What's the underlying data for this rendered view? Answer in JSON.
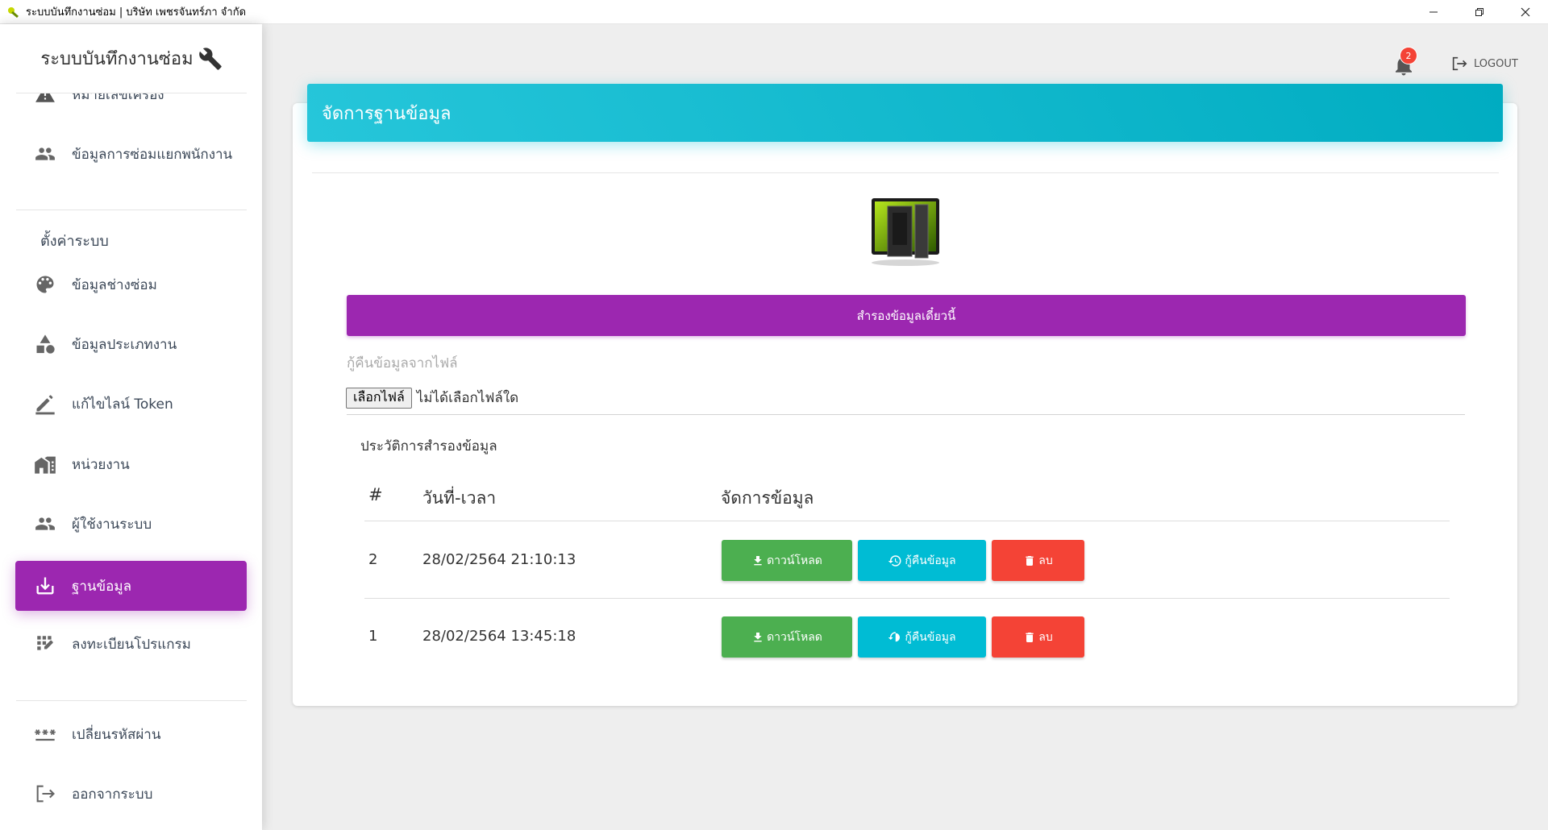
{
  "window": {
    "title": "ระบบบันทึกงานซ่อม | บริษัท เพชรจันทร์ภา จำกัด"
  },
  "sidebar": {
    "brand": "ระบบบันทึกงานซ่อม",
    "items_top": [
      {
        "label": "หมายเลขเครื่อง",
        "icon": "warning-icon"
      },
      {
        "label": "ข้อมูลการซ่อมแยกพนักงาน",
        "icon": "people-icon"
      }
    ],
    "section_label": "ตั้งค่าระบบ",
    "items_settings": [
      {
        "label": "ข้อมูลช่างซ่อม",
        "icon": "palette-icon"
      },
      {
        "label": "ข้อมูลประเภทงาน",
        "icon": "shapes-icon"
      },
      {
        "label": "แก้ไขไลน์ Token",
        "icon": "edit-icon"
      },
      {
        "label": "หน่วยงาน",
        "icon": "home-work-icon"
      },
      {
        "label": "ผู้ใช้งานระบบ",
        "icon": "people-icon"
      },
      {
        "label": "ฐานข้อมูล",
        "icon": "download-icon",
        "active": true
      },
      {
        "label": "ลงทะเบียนโปรแกรม",
        "icon": "grid-edit-icon"
      }
    ],
    "items_bottom": [
      {
        "label": "เปลี่ยนรหัสผ่าน",
        "icon": "password-icon"
      },
      {
        "label": "ออกจากระบบ",
        "icon": "logout-icon"
      }
    ]
  },
  "topbar": {
    "notification_count": "2",
    "logout_label": "LOGOUT"
  },
  "main": {
    "card_title": "จัดการฐานข้อมูล",
    "backup_button": "สำรองข้อมูลเดี๋ยวนี้",
    "restore_label": "กู้คืนข้อมูลจากไฟล์",
    "file_button": "เลือกไฟล์",
    "file_status": "ไม่ได้เลือกไฟล์ใด",
    "history_title": "ประวัติการสำรองข้อมูล",
    "table": {
      "headers": [
        "#",
        "วันที่-เวลา",
        "จัดการข้อมูล"
      ],
      "rows": [
        {
          "no": "2",
          "datetime": "28/02/2564 21:10:13"
        },
        {
          "no": "1",
          "datetime": "28/02/2564 13:45:18"
        }
      ],
      "actions": {
        "download": "ดาวน์โหลด",
        "restore": "กู้คืนข้อมูล",
        "delete": "ลบ"
      }
    }
  },
  "colors": {
    "primary_purple": "#9c27b0",
    "header_cyan": "#00bcd4",
    "success_green": "#4caf50",
    "danger_red": "#f44336"
  }
}
